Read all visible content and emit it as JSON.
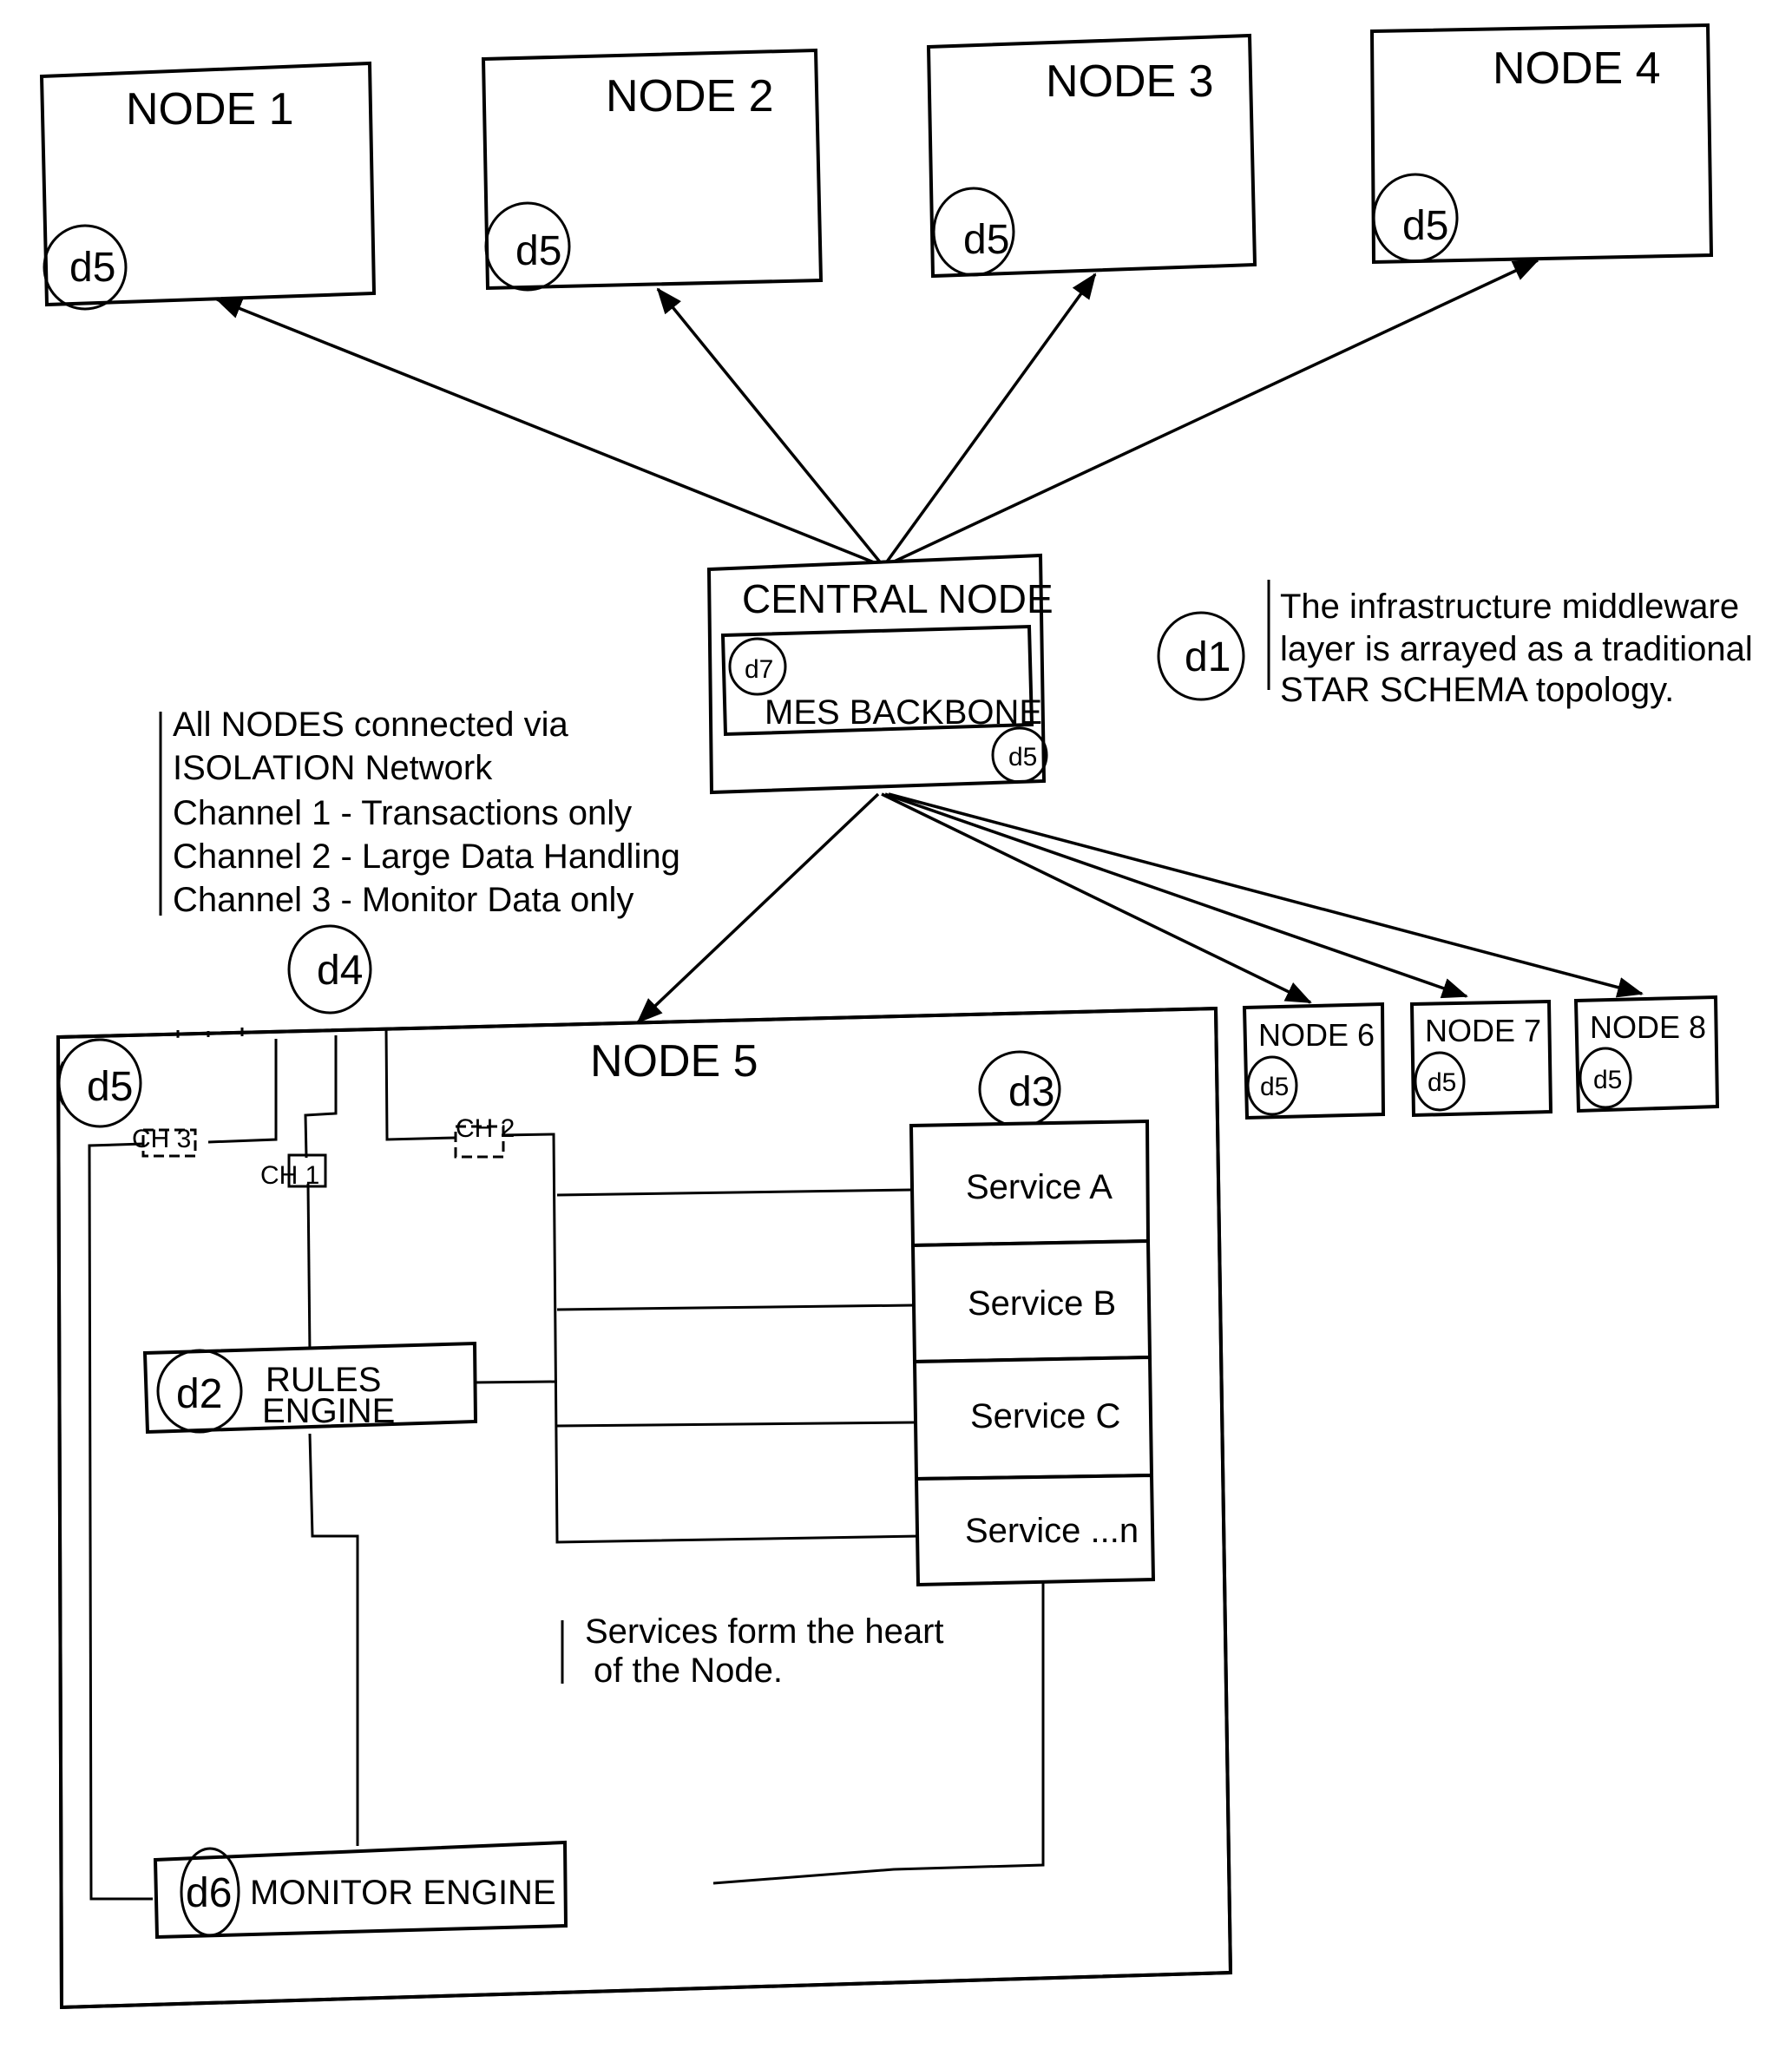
{
  "diagram": {
    "type": "star-topology-network",
    "outer_nodes_top": [
      {
        "label": "NODE 1",
        "ref": "d5"
      },
      {
        "label": "NODE 2",
        "ref": "d5"
      },
      {
        "label": "NODE 3",
        "ref": "d5"
      },
      {
        "label": "NODE 4",
        "ref": "d5"
      }
    ],
    "outer_nodes_right": [
      {
        "label": "NODE 6",
        "ref": "d5"
      },
      {
        "label": "NODE 7",
        "ref": "d5"
      },
      {
        "label": "NODE 8",
        "ref": "d5"
      }
    ],
    "central_node": {
      "label": "CENTRAL NODE",
      "inner_label": "MES BACKBONE",
      "inner_ref": "d7",
      "ref": "d5"
    },
    "note_d1": {
      "ref": "d1",
      "lines": [
        "The infrastructure middleware",
        "layer is arrayed as a traditional",
        "STAR SCHEMA topology."
      ]
    },
    "note_d4": {
      "ref": "d4",
      "lines": [
        "All NODES connected via",
        "ISOLATION Network",
        "Channel 1 - Transactions only",
        "Channel 2 - Large Data Handling",
        "Channel 3 - Monitor Data only"
      ]
    },
    "node5": {
      "label": "NODE 5",
      "ref": "d5",
      "channels": [
        "CH 1",
        "CH 2",
        "CH 3"
      ],
      "rules_engine": {
        "ref": "d2",
        "line1": "RULES",
        "line2": "ENGINE"
      },
      "services_ref": "d3",
      "services": [
        "Service A",
        "Service B",
        "Service C",
        "Service ...n"
      ],
      "services_note": [
        "Services form the heart",
        "of the Node."
      ],
      "monitor_engine": {
        "ref": "d6",
        "label": "MONITOR ENGINE"
      }
    }
  }
}
